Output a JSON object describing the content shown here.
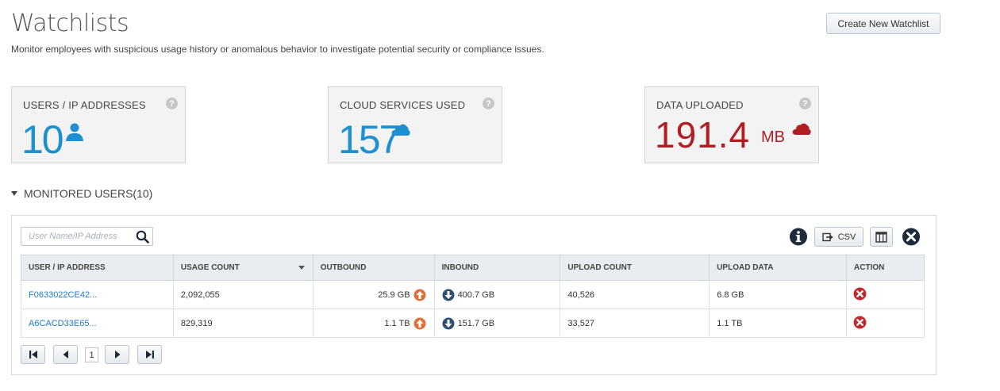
{
  "header": {
    "title": "Watchlists",
    "subtitle": "Monitor employees with suspicious usage history or anomalous behavior to investigate potential security or compliance issues.",
    "create_button": "Create New Watchlist"
  },
  "kpis": [
    {
      "label": "USERS / IP ADDRESSES",
      "value": "10",
      "unit": "",
      "icon": "user-icon",
      "color": "#1e8fd0"
    },
    {
      "label": "CLOUD SERVICES USED",
      "value": "157",
      "unit": "",
      "icon": "cloud-icon",
      "color": "#1e8fd0"
    },
    {
      "label": "DATA UPLOADED",
      "value": "191.4",
      "unit": "MB",
      "icon": "cloud-icon",
      "color": "#b01e23"
    }
  ],
  "section": {
    "title": "MONITORED USERS(10)"
  },
  "toolbar": {
    "search_placeholder": "User Name/IP Address",
    "csv_label": "CSV"
  },
  "table": {
    "columns": [
      "USER / IP ADDRESS",
      "USAGE COUNT",
      "OUTBOUND",
      "INBOUND",
      "UPLOAD COUNT",
      "UPLOAD DATA",
      "ACTION"
    ],
    "rows": [
      {
        "user": "F0633022CE42...",
        "usage_count": "2,092,055",
        "outbound": "25.9 GB",
        "inbound": "400.7 GB",
        "upload_count": "40,526",
        "upload_data": "6.8 GB"
      },
      {
        "user": "A6CACD33E65...",
        "usage_count": "829,319",
        "outbound": "1.1 TB",
        "inbound": "151.7 GB",
        "upload_count": "33,527",
        "upload_data": "1.1 TB"
      }
    ]
  },
  "pagination": {
    "current_page": "1"
  },
  "colors": {
    "accent_blue": "#1e8fd0",
    "alert_red": "#b01e23",
    "outbound_orange": "#e0703a",
    "inbound_navy": "#2c4f73",
    "remove_red": "#c0282d"
  }
}
